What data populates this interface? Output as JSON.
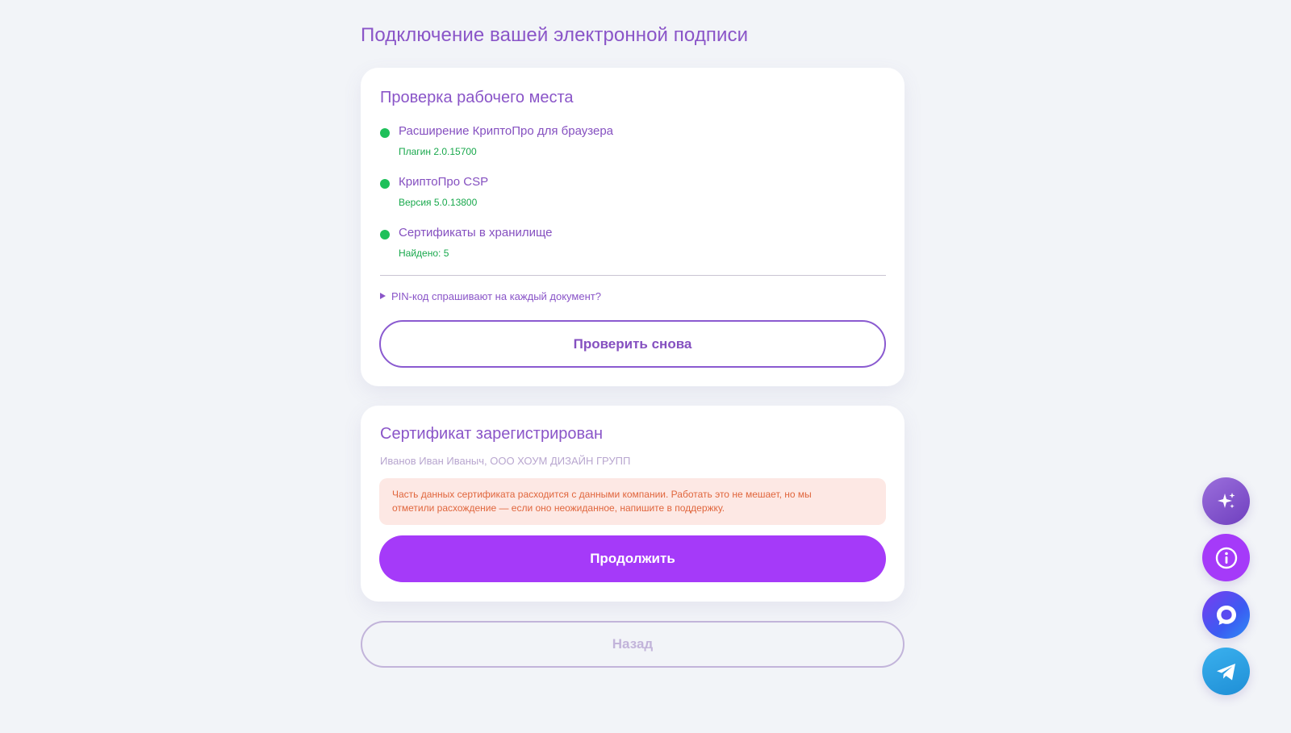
{
  "page": {
    "title": "Подключение вашей электронной подписи"
  },
  "workplace_check": {
    "title": "Проверка рабочего места",
    "items": [
      {
        "name": "Расширение КриптоПро для браузера",
        "detail": "Плагин 2.0.15700",
        "status_color": "#1ec05a"
      },
      {
        "name": "КриптоПро CSP",
        "detail": "Версия 5.0.13800",
        "status_color": "#1ec05a"
      },
      {
        "name": "Сертификаты в хранилище",
        "detail": "Найдено: 5",
        "status_color": "#1ec05a"
      }
    ],
    "faq_label": "PIN-код спрашивают на каждый документ?",
    "recheck_button": "Проверить снова"
  },
  "certificate": {
    "title": "Сертификат зарегистрирован",
    "owner": "Иванов Иван Иваныч, ООО ХОУМ ДИЗАЙН ГРУПП",
    "warning_line1": "Часть данных сертификата расходится с данными компании. Работать это не мешает, но мы",
    "warning_line2": "отметили расхождение — если оно неожиданное, напишите в поддержку.",
    "continue_button": "Продолжить"
  },
  "back_button": "Назад",
  "floating_actions": [
    {
      "icon": "sparkle-icon"
    },
    {
      "icon": "info-icon"
    },
    {
      "icon": "chat-bubble-icon"
    },
    {
      "icon": "telegram-icon"
    }
  ],
  "colors": {
    "accent": "#a53af9",
    "title": "#8a55c8",
    "success": "#1ec05a",
    "warning_bg": "#fde8e4",
    "warning_text": "#e0663d",
    "background": "#f2f4f8"
  }
}
